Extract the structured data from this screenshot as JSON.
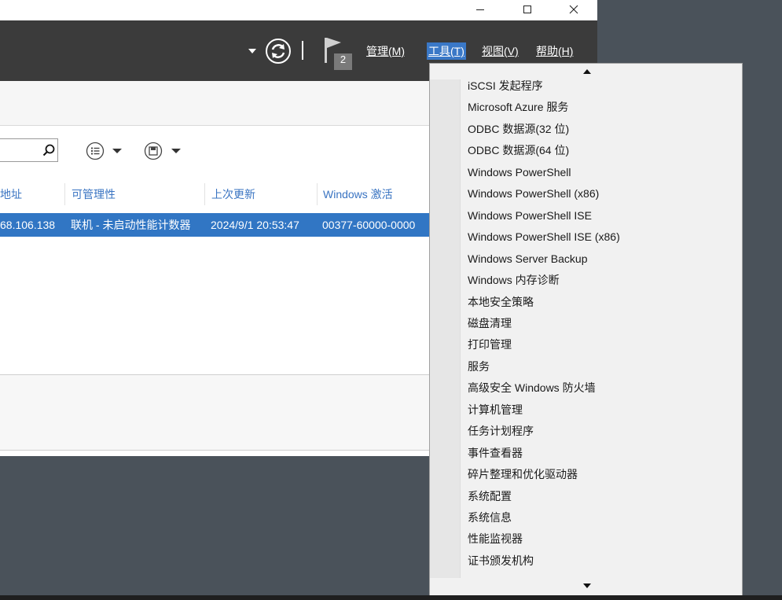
{
  "window_controls": [
    "minimize",
    "maximize",
    "close"
  ],
  "header": {
    "notification_count": "2",
    "menus": [
      {
        "label": "管理(M)"
      },
      {
        "label": "工具(T)"
      },
      {
        "label": "视图(V)"
      },
      {
        "label": "帮助(H)"
      }
    ],
    "active_menu": "工具(T)"
  },
  "search": {
    "value": "",
    "placeholder": ""
  },
  "table": {
    "columns": [
      "地址",
      "可管理性",
      "上次更新",
      "Windows 激活"
    ],
    "rows": [
      {
        "address": "68.106.138",
        "manageability": "联机 - 未启动性能计数器",
        "last_update": "2024/9/1 20:53:47",
        "activation": "00377-60000-0000"
      }
    ]
  },
  "tools_menu": {
    "items": [
      "iSCSI 发起程序",
      "Microsoft Azure 服务",
      "ODBC 数据源(32 位)",
      "ODBC 数据源(64 位)",
      "Windows PowerShell",
      "Windows PowerShell (x86)",
      "Windows PowerShell ISE",
      "Windows PowerShell ISE (x86)",
      "Windows Server Backup",
      "Windows 内存诊断",
      "本地安全策略",
      "磁盘清理",
      "打印管理",
      "服务",
      "高级安全 Windows 防火墙",
      "计算机管理",
      "任务计划程序",
      "事件查看器",
      "碎片整理和优化驱动器",
      "系统配置",
      "系统信息",
      "性能监视器",
      "证书颁发机构"
    ]
  },
  "colors": {
    "header_bg": "#3b3b3b",
    "accent": "#3176c4",
    "menu_highlight": "#3a78c7",
    "desktop_bg": "#4a525a"
  }
}
